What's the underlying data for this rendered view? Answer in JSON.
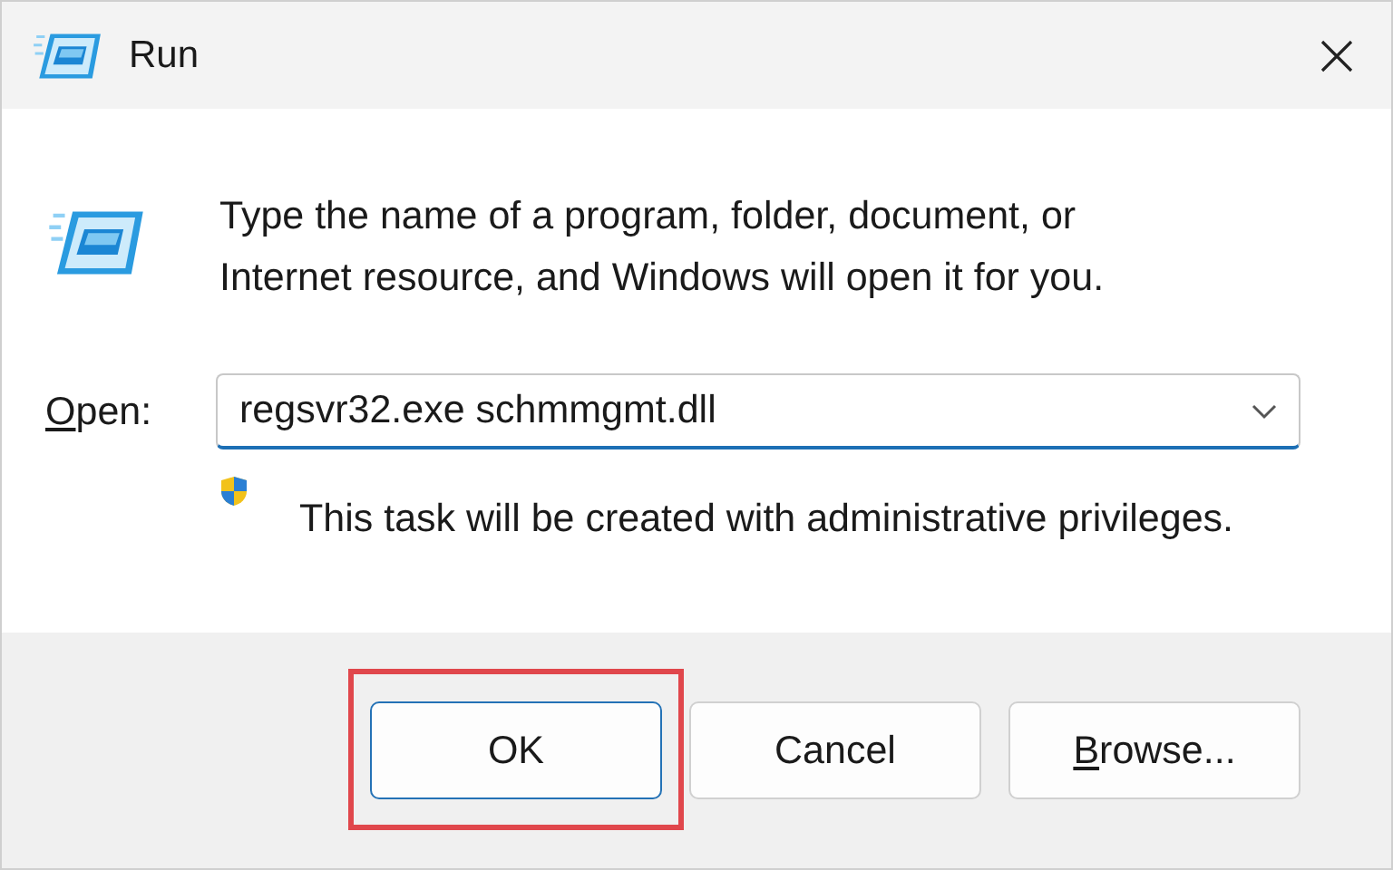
{
  "window": {
    "title": "Run"
  },
  "message": "Type the name of a program, folder, document, or Internet resource, and Windows will open it for you.",
  "open_field": {
    "label_access_key": "O",
    "label_rest": "pen:",
    "value": "regsvr32.exe schmmgmt.dll"
  },
  "admin_note": "This task will be created with administrative privileges.",
  "buttons": [
    {
      "label": "OK",
      "default": true,
      "highlighted": true
    },
    {
      "label": "Cancel",
      "default": false,
      "highlighted": false
    },
    {
      "access_key": "B",
      "label": "rowse...",
      "default": false,
      "highlighted": false
    }
  ]
}
